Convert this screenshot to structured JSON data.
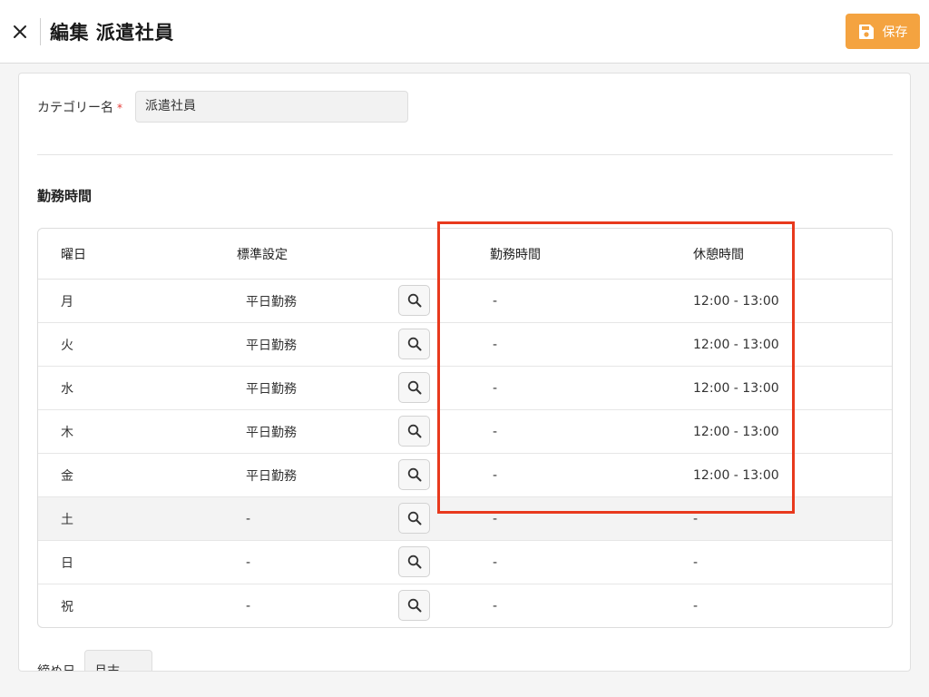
{
  "header": {
    "title": "編集 派遣社員",
    "save_label": "保存",
    "accent_color": "#f4a340"
  },
  "form": {
    "category_label": "カテゴリー名",
    "required_mark": "*",
    "category_value": "派遣社員"
  },
  "section": {
    "title": "勤務時間"
  },
  "table": {
    "headers": {
      "day": "曜日",
      "standard": "標準設定",
      "work": "勤務時間",
      "rest": "休憩時間"
    },
    "rows": [
      {
        "day": "月",
        "standard": "平日勤務",
        "work": "-",
        "rest": "12:00 - 13:00"
      },
      {
        "day": "火",
        "standard": "平日勤務",
        "work": "-",
        "rest": "12:00 - 13:00"
      },
      {
        "day": "水",
        "standard": "平日勤務",
        "work": "-",
        "rest": "12:00 - 13:00"
      },
      {
        "day": "木",
        "standard": "平日勤務",
        "work": "-",
        "rest": "12:00 - 13:00"
      },
      {
        "day": "金",
        "standard": "平日勤務",
        "work": "-",
        "rest": "12:00 - 13:00"
      },
      {
        "day": "土",
        "standard": "-",
        "work": "-",
        "rest": "-"
      },
      {
        "day": "日",
        "standard": "-",
        "work": "-",
        "rest": "-"
      },
      {
        "day": "祝",
        "standard": "-",
        "work": "-",
        "rest": "-"
      }
    ]
  },
  "footer": {
    "label": "締め日",
    "select_value": "月末"
  },
  "icons": {
    "close": "close-icon",
    "save": "floppy-disk-icon",
    "search": "search-icon"
  },
  "annotation_color": "#e8391d"
}
